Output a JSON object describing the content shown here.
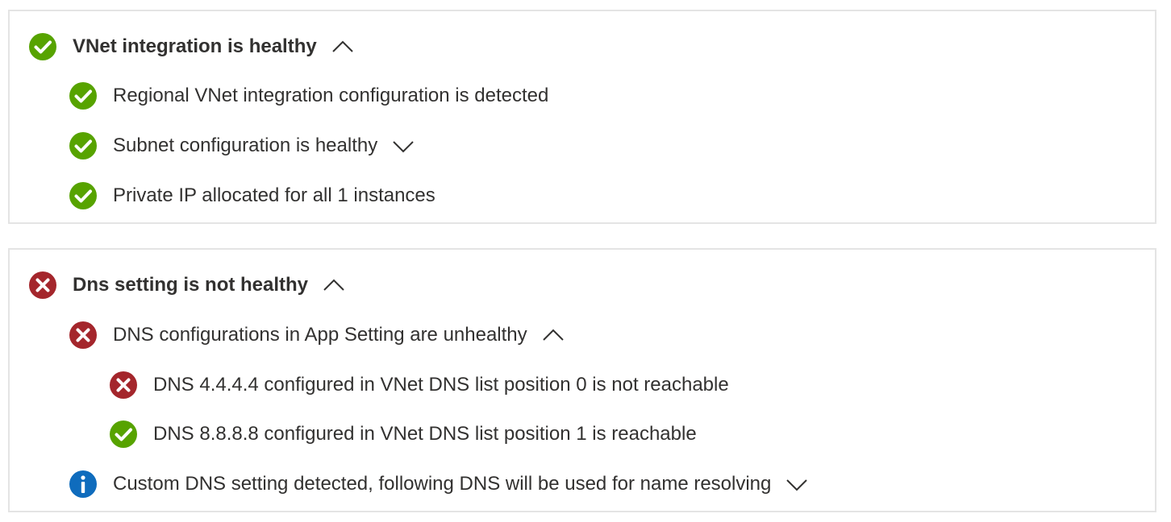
{
  "colors": {
    "success": "#57a300",
    "error": "#a4262c",
    "info": "#0f6cbd",
    "border": "#e4e4e4",
    "text": "#323130"
  },
  "vnet_panel": {
    "header": {
      "label": "VNet integration is healthy",
      "status_icon": "success-check-icon",
      "expander": "chevron-up-icon"
    },
    "items": [
      {
        "label": "Regional VNet integration configuration is detected",
        "status_icon": "success-check-icon"
      },
      {
        "label": "Subnet configuration is healthy",
        "status_icon": "success-check-icon",
        "expander": "chevron-down-icon"
      },
      {
        "label": "Private IP allocated for all 1 instances",
        "status_icon": "success-check-icon"
      }
    ]
  },
  "dns_panel": {
    "header": {
      "label": "Dns setting is not healthy",
      "status_icon": "error-x-icon",
      "expander": "chevron-up-icon"
    },
    "items": [
      {
        "label": "DNS configurations in App Setting are unhealthy",
        "status_icon": "error-x-icon",
        "expander": "chevron-up-icon",
        "children": [
          {
            "label": "DNS 4.4.4.4 configured in VNet DNS list position 0 is not reachable",
            "status_icon": "error-x-icon"
          },
          {
            "label": "DNS 8.8.8.8 configured in VNet DNS list position 1 is reachable",
            "status_icon": "success-check-icon"
          }
        ]
      },
      {
        "label": "Custom DNS setting detected, following DNS will be used for name resolving",
        "status_icon": "info-icon",
        "expander": "chevron-down-icon"
      }
    ]
  }
}
